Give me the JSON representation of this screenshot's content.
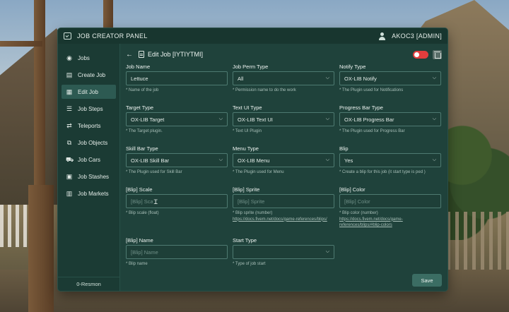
{
  "window": {
    "title": "JOB CREATOR PANEL",
    "user": "AKOC3 [ADMIN]"
  },
  "sidebar": {
    "items": [
      {
        "label": "Jobs",
        "icon": "database-icon"
      },
      {
        "label": "Create Job",
        "icon": "document-add-icon"
      },
      {
        "label": "Edit Job",
        "icon": "document-edit-icon",
        "active": true
      },
      {
        "label": "Job Steps",
        "icon": "list-icon"
      },
      {
        "label": "Teleports",
        "icon": "route-icon"
      },
      {
        "label": "Job Objects",
        "icon": "objects-icon"
      },
      {
        "label": "Job Cars",
        "icon": "car-icon"
      },
      {
        "label": "Job Stashes",
        "icon": "stash-icon"
      },
      {
        "label": "Job Markets",
        "icon": "market-icon"
      }
    ],
    "footer": "0-Resmon"
  },
  "header": {
    "back": "←",
    "title": "Edit Job [IYTIYTMI]",
    "enabled": false
  },
  "fields": [
    {
      "label": "Job Name",
      "value": "Lettuce",
      "placeholder": "",
      "type": "text",
      "hint": "* Name of the job"
    },
    {
      "label": "Job Perm Type",
      "value": "All",
      "placeholder": "",
      "type": "select",
      "hint": "* Permission name to do the work"
    },
    {
      "label": "Notify Type",
      "value": "OX-LIB Notify",
      "placeholder": "",
      "type": "select",
      "hint": "* The Plugin used for Notifications"
    },
    {
      "label": "Target Type",
      "value": "OX-LIB Target",
      "placeholder": "",
      "type": "select",
      "hint": "* The Target plugin."
    },
    {
      "label": "Text UI Type",
      "value": "OX-LIB Text UI",
      "placeholder": "",
      "type": "select",
      "hint": "* Text UI Plugin"
    },
    {
      "label": "Progress Bar Type",
      "value": "OX-LIB Progress Bar",
      "placeholder": "",
      "type": "select",
      "hint": "* The Plugin used for Progress Bar"
    },
    {
      "label": "Skill Bar Type",
      "value": "OX-LIB Skill Bar",
      "placeholder": "",
      "type": "select",
      "hint": "* The Plugin used for Skill Bar"
    },
    {
      "label": "Menu Type",
      "value": "OX-LIB Menu",
      "placeholder": "",
      "type": "select",
      "hint": "* The Plugin used for Menu"
    },
    {
      "label": "Blip",
      "value": "Yes",
      "placeholder": "",
      "type": "select",
      "hint": "* Create a blip for this job (it start type is ped )"
    },
    {
      "label": "[Blip] Scale",
      "value": "",
      "placeholder": "[Blip] Scale",
      "type": "text",
      "hint": "* Blip scale (float)"
    },
    {
      "label": "[Blip] Sprite",
      "value": "",
      "placeholder": "[Blip] Sprite",
      "type": "text",
      "hint": "* Blip sprite (number)",
      "link": "https://docs.fivem.net/docs/game-references/blips/"
    },
    {
      "label": "[Blip] Color",
      "value": "",
      "placeholder": "[Blip] Color",
      "type": "text",
      "hint": "* Blip color (number)",
      "link": "https://docs.fivem.net/docs/game-references/blips/#blip-colors"
    },
    {
      "label": "[Blip] Name",
      "value": "",
      "placeholder": "[Blip] Name",
      "type": "text",
      "hint": "* Blip name"
    },
    {
      "label": "Start Type",
      "value": "",
      "placeholder": "",
      "type": "select",
      "hint": "* Type of job start"
    }
  ],
  "save_label": "Save",
  "colors": {
    "panel": "#1f423b",
    "accent": "#3b6d63",
    "toggle_off": "#e23d3d"
  }
}
